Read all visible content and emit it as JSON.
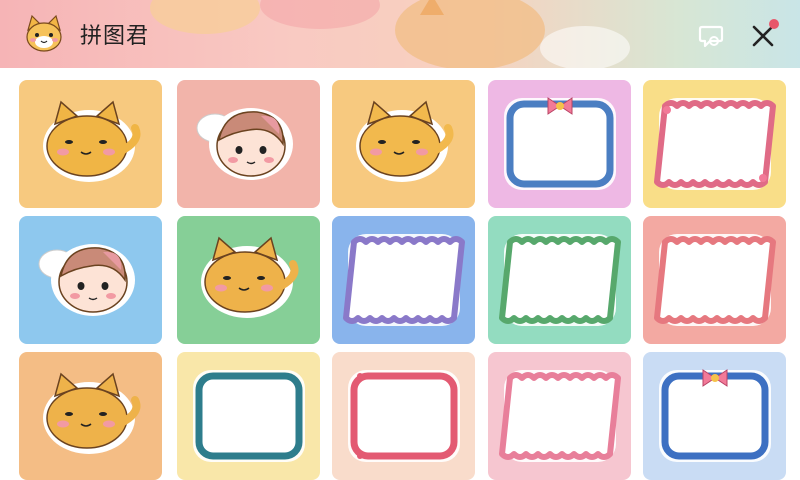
{
  "header": {
    "app_name": "拼图君",
    "logo_icon": "cat-face-icon",
    "actions": [
      {
        "name": "comment",
        "icon": "speech-bubble-icon"
      },
      {
        "name": "close",
        "icon": "close-icon"
      }
    ],
    "notification_dot": true
  },
  "colors": {
    "accent_red": "#e8576a",
    "header_gradient": [
      "#f6b4b6",
      "#f9c9c2",
      "#d7e6d4",
      "#c9e5e7"
    ]
  },
  "sticker_grid": {
    "rows": [
      [
        {
          "kind": "cat",
          "fur": "#f0b545",
          "bg": "#f7c97f"
        },
        {
          "kind": "girl",
          "fur": "#c98a78",
          "bg": "#f2b4aa"
        },
        {
          "kind": "cat",
          "fur": "#f2b94d",
          "bg": "#f7c97f"
        },
        {
          "kind": "frame",
          "style": "bow",
          "border": "#4b7ec2",
          "bg": "#eeb8e4"
        },
        {
          "kind": "frame",
          "style": "vine",
          "border": "#e06b86",
          "bg": "#f9de88"
        }
      ],
      [
        {
          "kind": "girl",
          "fur": "#c98a78",
          "bg": "#8ec8ee"
        },
        {
          "kind": "cat",
          "fur": "#eeb24a",
          "bg": "#86cf97"
        },
        {
          "kind": "frame",
          "style": "wavy",
          "border": "#8a79c9",
          "bg": "#89b4ec"
        },
        {
          "kind": "frame",
          "style": "wavy",
          "border": "#57a86c",
          "bg": "#93dcc0"
        },
        {
          "kind": "frame",
          "style": "wavy",
          "border": "#e6787f",
          "bg": "#f3a9a2"
        }
      ],
      [
        {
          "kind": "cat",
          "fur": "#eeb24a",
          "bg": "#f4bd85"
        },
        {
          "kind": "frame",
          "style": "plain",
          "border": "#2e7d8c",
          "bg": "#f9e7a9"
        },
        {
          "kind": "frame",
          "style": "dots",
          "border": "#e35a72",
          "bg": "#f9dccb"
        },
        {
          "kind": "frame",
          "style": "wavy",
          "border": "#e87f9a",
          "bg": "#f6c6d0"
        },
        {
          "kind": "frame",
          "style": "bow",
          "border": "#3d70c2",
          "bg": "#c9dcf4"
        }
      ]
    ]
  }
}
